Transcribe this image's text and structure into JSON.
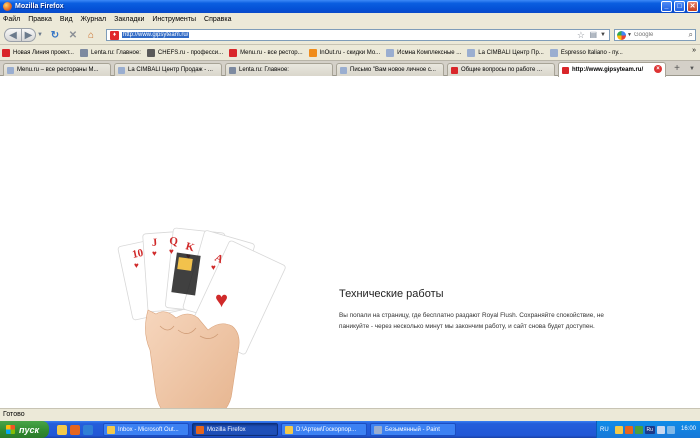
{
  "window": {
    "title": "Mozilla Firefox",
    "buttons": [
      "_",
      "□",
      "✕"
    ]
  },
  "menu": [
    "Файл",
    "Правка",
    "Вид",
    "Журнал",
    "Закладки",
    "Инструменты",
    "Справка"
  ],
  "nav": {
    "url": "http://www.gipsyteam.ru/",
    "search_placeholder": "Google"
  },
  "bookmarks": [
    {
      "label": "Новая Линия проект...",
      "color": "#d9262a"
    },
    {
      "label": "Lenta.ru: Главное:",
      "color": "#7d8aa0"
    },
    {
      "label": "CHEFS.ru - професси...",
      "color": "#5a5a5a"
    },
    {
      "label": "Menu.ru - все рестор...",
      "color": "#d9262a"
    },
    {
      "label": "InOut.ru - скидки Мо...",
      "color": "#f08c1a"
    },
    {
      "label": "Исмна Комплексные ...",
      "color": "#9aaed0"
    },
    {
      "label": "La CIMBALI Центр Пр...",
      "color": "#9aaed0"
    },
    {
      "label": "Espresso Italiano - пу...",
      "color": "#9aaed0"
    }
  ],
  "bookmarks_more": "»",
  "tabs": [
    {
      "label": "Menu.ru – все рестораны М...",
      "color": "#9aaed0",
      "active": false
    },
    {
      "label": "La CIMBALI Центр Продаж - ...",
      "color": "#9aaed0",
      "active": false
    },
    {
      "label": "Lenta.ru: Главное:",
      "color": "#7d8aa0",
      "active": false
    },
    {
      "label": "Письмо \"Вам новое личное с...",
      "color": "#9aaed0",
      "active": false
    },
    {
      "label": "Общие вопросы по работе ...",
      "color": "#d9262a",
      "active": false
    },
    {
      "label": "http://www.gipsyteam.ru/",
      "color": "#d9262a",
      "active": true
    }
  ],
  "page": {
    "title": "Технические работы",
    "text": "Вы попали на страницу, где бесплатно раздают Royal Flush. Сохраняйте спокойствие, не паникуйте - через несколько минут мы закончим работу, и сайт снова будет доступен."
  },
  "status": "Готово",
  "taskbar": {
    "start": "пуск",
    "tasks": [
      {
        "label": "Inbox - Microsoft Out...",
        "color": "#f2c94c",
        "active": false
      },
      {
        "label": "Mozilla Firefox",
        "color": "#e5651e",
        "active": true
      },
      {
        "label": "D:\\Артем\\Госкорпор...",
        "color": "#f2c94c",
        "active": false
      },
      {
        "label": "Безымянный - Paint",
        "color": "#9aaed0",
        "active": false
      }
    ],
    "lang": "RU",
    "lang_indicator": "Ru",
    "clock": "16:00"
  }
}
